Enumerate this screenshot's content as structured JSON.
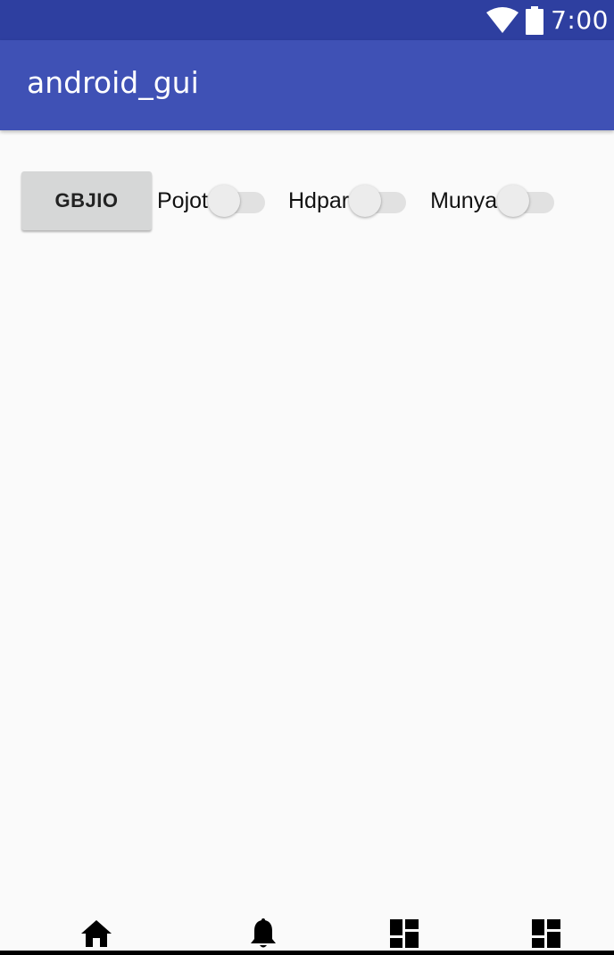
{
  "status_bar": {
    "time": "7:00",
    "icons": [
      "wifi-icon",
      "battery-icon"
    ]
  },
  "app_bar": {
    "title": "android_gui"
  },
  "content": {
    "button_label": "GBJIO",
    "switches": [
      {
        "label": "Pojot",
        "checked": false
      },
      {
        "label": "Hdpar",
        "checked": false
      },
      {
        "label": "Munya",
        "checked": false
      }
    ]
  },
  "bottom_nav": {
    "items": [
      "home-icon",
      "bell-icon",
      "dashboard-icon",
      "dashboard-icon"
    ]
  },
  "colors": {
    "status_bar": "#2e3fa0",
    "app_bar": "#3f51b5",
    "background": "#fafafa",
    "button": "#d6d7d7"
  }
}
